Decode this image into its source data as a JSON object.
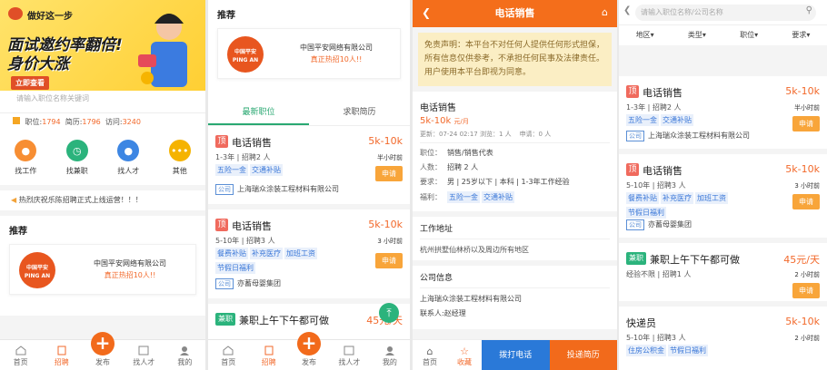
{
  "colors": {
    "accent": "#f2692b",
    "green": "#2aa872",
    "blue": "#2a79d8",
    "apply": "#f8a53a"
  },
  "tabbar": {
    "items": [
      "首页",
      "招聘",
      "发布",
      "找人才",
      "我的"
    ]
  },
  "p1": {
    "banner": {
      "tag": "做好这一步",
      "line1": "面试邀约率翻倍!",
      "line2": "身价大涨",
      "button": "立即查看"
    },
    "search_placeholder": "请输入职位名称关键词",
    "stats": {
      "jobs_label": "职位:",
      "jobs": "1794",
      "resumes_label": "简历:",
      "resumes": "1796",
      "visits_label": "访问:",
      "visits": "3240"
    },
    "nav": [
      {
        "label": "找工作",
        "icon": "user-search-icon"
      },
      {
        "label": "找兼职",
        "icon": "clock-icon"
      },
      {
        "label": "找人才",
        "icon": "person-icon"
      },
      {
        "label": "其他",
        "icon": "more-icon"
      }
    ],
    "notice": "热烈庆祝乐陈招聘正式上线运营！！！",
    "recommend": "推荐",
    "company": {
      "logo_cn": "中国平安",
      "logo_en": "PING AN",
      "name": "中国平安网络有限公司",
      "hot": "真正热招10人!!"
    }
  },
  "p2": {
    "recommend": "推荐",
    "company": {
      "logo_cn": "中国平安",
      "logo_en": "PING AN",
      "name": "中国平安网络有限公司",
      "hot": "真正热招10人!!"
    },
    "tabs": [
      "最新职位",
      "求职简历"
    ],
    "jobs": [
      {
        "badge": "顶",
        "title": "电话销售",
        "salary": "5k-10k",
        "meta": "1-3年 | 招聘2 人",
        "time": "半小时前",
        "tags": [
          "五险一金",
          "交通补贴"
        ],
        "company_tag": "公司",
        "company": "上海瑞众涂装工程材料有限公司",
        "apply": "申请"
      },
      {
        "badge": "顶",
        "title": "电话销售",
        "salary": "5k-10k",
        "meta": "5-10年 | 招聘3 人",
        "time": "3 小时前",
        "tags": [
          "餐费补贴",
          "补充医疗",
          "加班工资",
          "节假日福利"
        ],
        "company_tag": "公司",
        "company": "亦蓄母婴集团",
        "apply": "申请"
      },
      {
        "badge": "兼职",
        "title": "兼职上午下午都可做",
        "salary": "45元/天"
      }
    ]
  },
  "p3": {
    "title": "电话销售",
    "disclaimer": "免责声明：本平台不对任何人提供任何形式担保，所有信息仅供参考，不承担任何民事及法律责任。用户使用本平台即视为同意。",
    "job": {
      "title": "电话销售",
      "salary": "5k-10k",
      "unit": "元/月",
      "updated": "更新：07-24 02:17 浏览：1 人",
      "apply_count": "申请：0 人"
    },
    "rows": [
      {
        "k": "职位：",
        "v": "销售/销售代表"
      },
      {
        "k": "人数：",
        "v": "招聘 2 人"
      },
      {
        "k": "要求：",
        "v": "男 | 25岁以下 | 本科 | 1-3年工作经验"
      },
      {
        "k": "福利：",
        "v": ""
      }
    ],
    "tags": [
      "五险一金",
      "交通补贴"
    ],
    "address_title": "工作地址",
    "address": "杭州拱墅仙林桥以及周边所有地区",
    "company_title": "公司信息",
    "company": "上海瑞众涂装工程材料有限公司",
    "contact": "联系人:赵经理",
    "bottom": {
      "home": "首页",
      "fav": "收藏",
      "call": "拨打电话",
      "deliver": "投递简历"
    }
  },
  "p4": {
    "search_placeholder": "请输入职位名称/公司名称",
    "filters": [
      "地区",
      "类型",
      "职位",
      "要求"
    ],
    "jobs": [
      {
        "badge": "顶",
        "title": "电话销售",
        "salary": "5k-10k",
        "meta": "1-3年 | 招聘2 人",
        "time": "半小时前",
        "tags": [
          "五险一金",
          "交通补贴"
        ],
        "company_tag": "公司",
        "company": "上海瑞众涂装工程材料有限公司",
        "apply": "申请"
      },
      {
        "badge": "顶",
        "title": "电话销售",
        "salary": "5k-10k",
        "meta": "5-10年 | 招聘3 人",
        "time": "3 小时前",
        "tags": [
          "餐费补贴",
          "补充医疗",
          "加班工资",
          "节假日福利"
        ],
        "company_tag": "公司",
        "company": "亦蓄母婴集团",
        "apply": "申请"
      },
      {
        "badge": "兼职",
        "title": "兼职上午下午都可做",
        "salary": "45元/天",
        "meta": "经验不限 | 招聘1 人",
        "time": "2 小时前",
        "apply": "申请"
      },
      {
        "title": "快递员",
        "salary": "5k-10k",
        "meta": "5-10年 | 招聘3 人",
        "time": "2 小时前",
        "tags": [
          "住房公积金",
          "节假日福利"
        ]
      }
    ]
  }
}
